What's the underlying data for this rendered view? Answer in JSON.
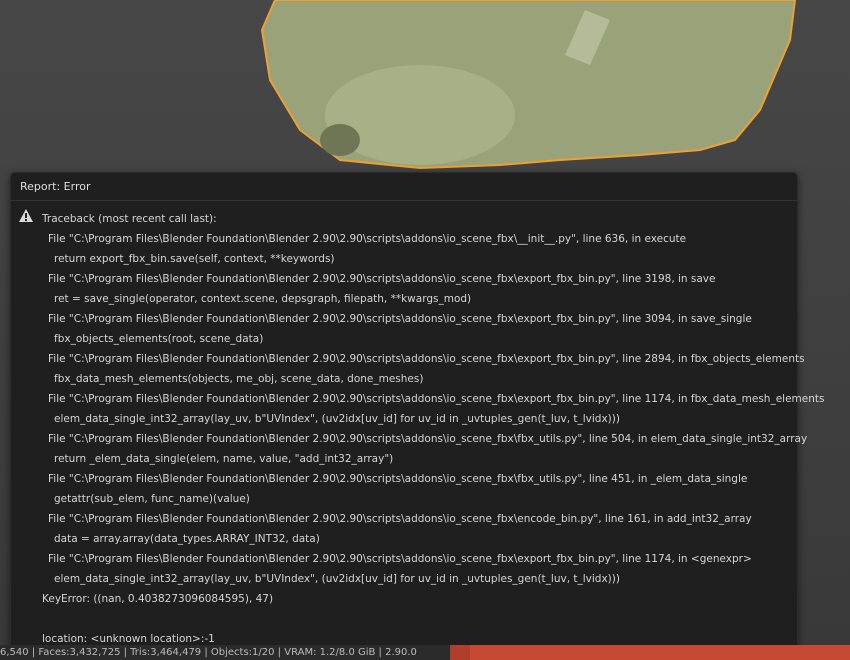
{
  "colors": {
    "mesh": "#9aa27a",
    "outline": "#f0a030",
    "error": "#c64a33"
  },
  "report": {
    "title": "Report: Error",
    "icon": "warning-icon",
    "lines": [
      {
        "t": "h",
        "text": "Traceback (most recent call last):"
      },
      {
        "t": "f",
        "text": "File \"C:\\Program Files\\Blender Foundation\\Blender 2.90\\2.90\\scripts\\addons\\io_scene_fbx\\__init__.py\", line 636, in execute"
      },
      {
        "t": "c",
        "text": "return export_fbx_bin.save(self, context, **keywords)"
      },
      {
        "t": "f",
        "text": "File \"C:\\Program Files\\Blender Foundation\\Blender 2.90\\2.90\\scripts\\addons\\io_scene_fbx\\export_fbx_bin.py\", line 3198, in save"
      },
      {
        "t": "c",
        "text": "ret = save_single(operator, context.scene, depsgraph, filepath, **kwargs_mod)"
      },
      {
        "t": "f",
        "text": "File \"C:\\Program Files\\Blender Foundation\\Blender 2.90\\2.90\\scripts\\addons\\io_scene_fbx\\export_fbx_bin.py\", line 3094, in save_single"
      },
      {
        "t": "c",
        "text": "fbx_objects_elements(root, scene_data)"
      },
      {
        "t": "f",
        "text": "File \"C:\\Program Files\\Blender Foundation\\Blender 2.90\\2.90\\scripts\\addons\\io_scene_fbx\\export_fbx_bin.py\", line 2894, in fbx_objects_elements"
      },
      {
        "t": "c",
        "text": "fbx_data_mesh_elements(objects, me_obj, scene_data, done_meshes)"
      },
      {
        "t": "f",
        "text": "File \"C:\\Program Files\\Blender Foundation\\Blender 2.90\\2.90\\scripts\\addons\\io_scene_fbx\\export_fbx_bin.py\", line 1174, in fbx_data_mesh_elements"
      },
      {
        "t": "c",
        "text": "elem_data_single_int32_array(lay_uv, b\"UVIndex\", (uv2idx[uv_id] for uv_id in _uvtuples_gen(t_luv, t_lvidx)))"
      },
      {
        "t": "f",
        "text": "File \"C:\\Program Files\\Blender Foundation\\Blender 2.90\\2.90\\scripts\\addons\\io_scene_fbx\\fbx_utils.py\", line 504, in elem_data_single_int32_array"
      },
      {
        "t": "c",
        "text": "return _elem_data_single(elem, name, value, \"add_int32_array\")"
      },
      {
        "t": "f",
        "text": "File \"C:\\Program Files\\Blender Foundation\\Blender 2.90\\2.90\\scripts\\addons\\io_scene_fbx\\fbx_utils.py\", line 451, in _elem_data_single"
      },
      {
        "t": "c",
        "text": "getattr(sub_elem, func_name)(value)"
      },
      {
        "t": "f",
        "text": "File \"C:\\Program Files\\Blender Foundation\\Blender 2.90\\2.90\\scripts\\addons\\io_scene_fbx\\encode_bin.py\", line 161, in add_int32_array"
      },
      {
        "t": "c",
        "text": "data = array.array(data_types.ARRAY_INT32, data)"
      },
      {
        "t": "f",
        "text": "File \"C:\\Program Files\\Blender Foundation\\Blender 2.90\\2.90\\scripts\\addons\\io_scene_fbx\\export_fbx_bin.py\", line 1174, in <genexpr>"
      },
      {
        "t": "c",
        "text": "elem_data_single_int32_array(lay_uv, b\"UVIndex\", (uv2idx[uv_id] for uv_id in _uvtuples_gen(t_luv, t_lvidx)))"
      },
      {
        "t": "h",
        "text": "KeyError: ((nan, 0.4038273096084595), 47)"
      },
      {
        "t": "b",
        "text": ""
      },
      {
        "t": "h",
        "text": "location: <unknown location>:-1"
      }
    ]
  },
  "statusbar": {
    "text": "6,540 | Faces:3,432,725 | Tris:3,464,479 | Objects:1/20 | VRAM: 1.2/8.0 GiB | 2.90.0"
  }
}
